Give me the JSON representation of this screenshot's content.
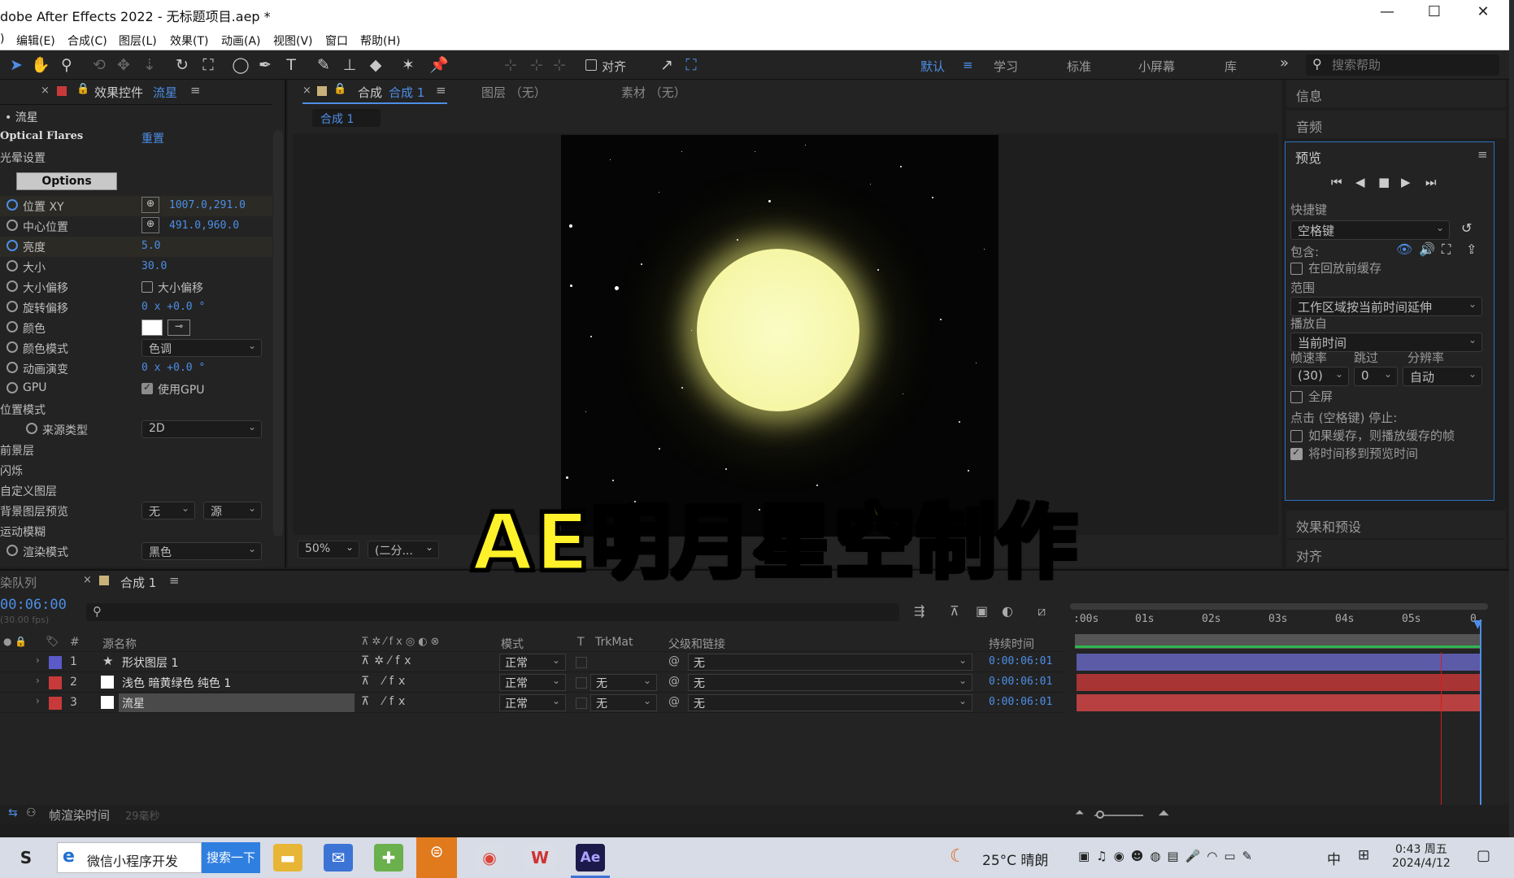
{
  "window": {
    "title": "dobe After Effects 2022 - 无标题项目.aep *",
    "minimize": "—",
    "maximize": "☐",
    "close": "✕"
  },
  "menu": [
    "编辑(E)",
    "合成(C)",
    "图层(L)",
    "效果(T)",
    "动画(A)",
    "视图(V)",
    "窗口",
    "帮助(H)"
  ],
  "menu_left_stub": ")",
  "toolbar": {
    "align_label": "对齐",
    "workspaces": [
      "默认",
      "学习",
      "标准",
      "小屏幕",
      "库"
    ],
    "active_workspace": "默认",
    "overflow": "»",
    "search_placeholder": "搜索帮助"
  },
  "effect_controls": {
    "tab_title": "效果控件",
    "tab_layer": "流星",
    "breadcrumb": "• 流星",
    "effect_name": "Optical Flares",
    "reset": "重置",
    "section_light": "光晕设置",
    "options_button": "Options",
    "props": [
      {
        "label": "位置 XY",
        "value": "1007.0,291.0",
        "stopwatch_on": true
      },
      {
        "label": "中心位置",
        "value": "491.0,960.0",
        "stopwatch_on": false
      },
      {
        "label": "亮度",
        "value": "5.0",
        "stopwatch_on": true
      },
      {
        "label": "大小",
        "value": "30.0",
        "stopwatch_on": false
      },
      {
        "label": "大小偏移",
        "value": "大小偏移",
        "stopwatch_on": false
      },
      {
        "label": "旋转偏移",
        "value": "0 x +0.0 °",
        "stopwatch_on": false
      },
      {
        "label": "颜色",
        "value": "",
        "stopwatch_on": false
      },
      {
        "label": "颜色模式",
        "value": "色调",
        "stopwatch_on": false
      },
      {
        "label": "动画演变",
        "value": "0 x +0.0 °",
        "stopwatch_on": false
      },
      {
        "label": "GPU",
        "value": "使用GPU",
        "stopwatch_on": false
      }
    ],
    "position_mode": "位置模式",
    "source_type_label": "来源类型",
    "source_type_value": "2D",
    "foreground": "前景层",
    "flicker": "闪烁",
    "custom_layer": "自定义图层",
    "bg_preview_label": "背景图层预览",
    "bg_preview_value1": "无",
    "bg_preview_value2": "源",
    "motion_blur": "运动模糊",
    "render_mode_label": "渲染模式",
    "render_mode_value": "黑色",
    "white_color": "#ffffff"
  },
  "composition": {
    "tab_label": "合成",
    "tab_name": "合成 1",
    "layer_tab": "图层 （无）",
    "footage_tab": "素材 （无）",
    "breadcrumb": "合成 1",
    "zoom": "50%",
    "resolution": "(二分...",
    "moon_color": "#f7f7ac"
  },
  "right_panels": {
    "info": "信息",
    "audio": "音频",
    "preview": {
      "title": "预览",
      "shortcut_label": "快捷键",
      "shortcut_value": "空格键",
      "include_label": "包含:",
      "cache_before_play": "在回放前缓存",
      "range_label": "范围",
      "range_value": "工作区域按当前时间延伸",
      "play_from_label": "播放自",
      "play_from_value": "当前时间",
      "fps_label": "帧速率",
      "skip_label": "跳过",
      "resolution_label": "分辨率",
      "fps_value": "(30)",
      "skip_value": "0",
      "resolution_value": "自动",
      "fullscreen": "全屏",
      "stop_hint": "点击 (空格键) 停止:",
      "if_cached": "如果缓存，则播放缓存的帧",
      "move_time": "将时间移到预览时间"
    },
    "effects_presets": "效果和预设",
    "align": "对齐"
  },
  "timeline": {
    "render_queue": "染队列",
    "comp_tab": "合成 1",
    "timecode": "00:06:00",
    "fps_hint": "(30.00 fps)",
    "columns": {
      "source_name": "源名称",
      "mode": "模式",
      "t": "T",
      "trkmat": "TrkMat",
      "parent": "父级和链接",
      "duration": "持续时间"
    },
    "ruler": [
      ":00s",
      "01s",
      "02s",
      "03s",
      "04s",
      "05s",
      "0"
    ],
    "layers": [
      {
        "num": "1",
        "name": "形状图层 1",
        "color": "#5a5ac8",
        "mode": "正常",
        "trkmat": "",
        "parent": "无",
        "duration": "0:00:06:01",
        "bar": "#5b5ba8",
        "icon": "★"
      },
      {
        "num": "2",
        "name": "浅色 暗黄绿色 纯色 1",
        "color": "#c83a3a",
        "mode": "正常",
        "trkmat": "无",
        "parent": "无",
        "duration": "0:00:06:01",
        "bar": "#a83434",
        "icon": "■"
      },
      {
        "num": "3",
        "name": "流星",
        "color": "#c83a3a",
        "mode": "正常",
        "trkmat": "无",
        "parent": "无",
        "duration": "0:00:06:01",
        "bar": "#a83434",
        "icon": "■"
      }
    ],
    "footer_label": "帧渲染时间",
    "footer_value": "29毫秒"
  },
  "taskbar": {
    "search_text": "微信小程序开发",
    "search_button": "搜索一下",
    "weather": "25°C 晴朗",
    "ime": "中",
    "time": "0:43 周五",
    "date": "2024/4/12"
  },
  "overlay": {
    "caption": "AE明月星空制作"
  }
}
